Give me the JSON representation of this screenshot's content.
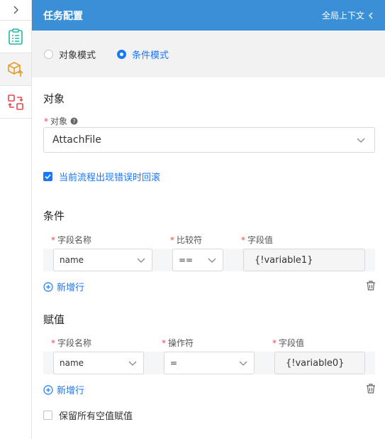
{
  "rail": {
    "toggle_icon": "chevron-right-icon",
    "items": [
      {
        "icon": "list-clipboard-icon",
        "color": "#21b8a6"
      },
      {
        "icon": "box-upload-icon",
        "color": "#e69b2a",
        "active": true
      },
      {
        "icon": "swap-icon",
        "color": "#e5484d"
      }
    ]
  },
  "header": {
    "title": "任务配置",
    "context_label": "全局上下文",
    "bg_color": "#3b8fd6"
  },
  "mode": {
    "options": [
      {
        "label": "对象模式",
        "checked": false
      },
      {
        "label": "条件模式",
        "checked": true
      }
    ]
  },
  "object_section": {
    "title": "对象",
    "field_label": "对象",
    "field_value": "AttachFile",
    "rollback_label": "当前流程出现错误时回滚",
    "rollback_checked": true
  },
  "conditions": {
    "title": "条件",
    "headers": [
      "字段名称",
      "比较符",
      "字段值"
    ],
    "rows": [
      {
        "field": "name",
        "operator": "==",
        "value": "{!variable1}"
      }
    ],
    "add_label": "新增行"
  },
  "assignments": {
    "title": "赋值",
    "headers": [
      "字段名称",
      "操作符",
      "字段值"
    ],
    "rows": [
      {
        "field": "name",
        "operator": "=",
        "value": "{!variable0}"
      }
    ],
    "add_label": "新增行"
  },
  "keep_empty": {
    "label": "保留所有空值赋值",
    "checked": false
  },
  "accent_color": "#1677ff"
}
